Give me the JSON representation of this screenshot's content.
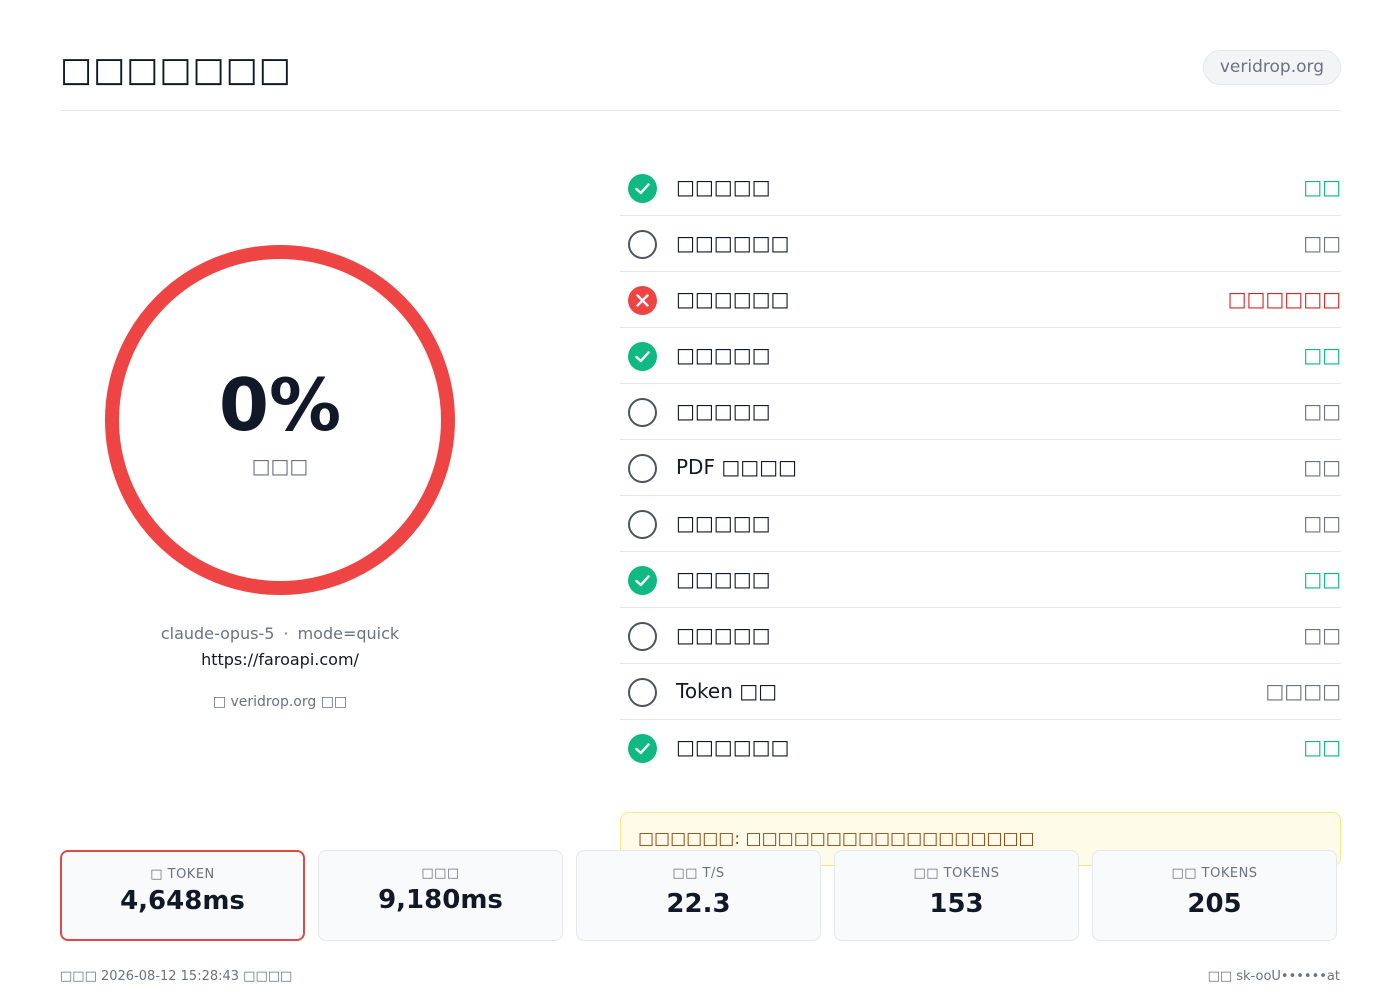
{
  "header": {
    "title": "□□□□□□□",
    "domain_badge": "veridrop.org"
  },
  "summary": {
    "score": "0%",
    "score_label": "□□□",
    "model": "claude-opus-5",
    "separator": "·",
    "mode": "mode=quick",
    "url": "https://faroapi.com/",
    "powered_by": "□ veridrop.org □□"
  },
  "checks": [
    {
      "name": "□□□□□",
      "status": "□□",
      "state": "ok"
    },
    {
      "name": "□□□□□□",
      "status": "□□",
      "state": "none"
    },
    {
      "name": "□□□□□□",
      "status": "□□□□□□",
      "state": "fail"
    },
    {
      "name": "□□□□□",
      "status": "□□",
      "state": "ok"
    },
    {
      "name": "□□□□□",
      "status": "□□",
      "state": "none"
    },
    {
      "name": "PDF □□□□",
      "status": "□□",
      "state": "none"
    },
    {
      "name": "□□□□□",
      "status": "□□",
      "state": "none"
    },
    {
      "name": "□□□□□",
      "status": "□□",
      "state": "ok"
    },
    {
      "name": "□□□□□",
      "status": "□□",
      "state": "none"
    },
    {
      "name": "Token □□",
      "status": "□□□□",
      "state": "none"
    },
    {
      "name": "□□□□□□",
      "status": "□□",
      "state": "ok"
    }
  ],
  "warning": {
    "text": "□□□□□□: □□□□□□□□□□□□□□□□□□"
  },
  "stats": [
    {
      "label": "□ TOKEN",
      "value": "4,648ms"
    },
    {
      "label": "□□□",
      "value": "9,180ms"
    },
    {
      "label": "□□ T/S",
      "value": "22.3"
    },
    {
      "label": "□□ TOKENS",
      "value": "153"
    },
    {
      "label": "□□ TOKENS",
      "value": "205"
    }
  ],
  "footer": {
    "left": "□□□ 2026-08-12 15:28:43 □□□□",
    "right": "□□ sk-ooU••••••at"
  },
  "colors": {
    "ok": "#10b981",
    "fail": "#ef4444",
    "neutral": "#6b7280",
    "accent_ring": "#ef4444"
  }
}
